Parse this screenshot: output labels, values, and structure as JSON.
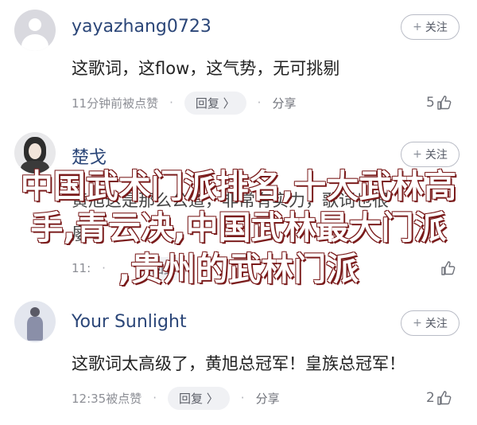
{
  "comments": [
    {
      "username": "yayazhang0723",
      "follow_label": "关注",
      "follow_icon": "+",
      "text": "这歌词，这flow，这气势，无可挑剔",
      "time": "11分钟前被点赞",
      "reply_label": "回复 〉",
      "share_label": "分享",
      "likes": "5",
      "avatar_icon": "default-user-icon"
    },
    {
      "username": "楚戈",
      "follow_label": "关注",
      "follow_icon": "+",
      "text": "黄旭这是那么公道，非常有实力，歌词也很",
      "text2": "屡",
      "time": "11:",
      "reply_label": "回复",
      "share_label": "",
      "likes": "",
      "avatar_icon": "user-photo"
    },
    {
      "username": "Your Sunlight",
      "follow_label": "关注",
      "follow_icon": "+",
      "text": "这歌词太高级了，黄旭总冠军！皇族总冠军！",
      "time": "12:35被点赞",
      "reply_label": "回复 〉",
      "share_label": "分享",
      "likes": "2",
      "avatar_icon": "user-photo"
    }
  ],
  "overlay": {
    "line1": "中国武术门派排名,十大武林高",
    "line2": "手,青云决,中国武林最大门派",
    "line3": ",贵州的武林门派"
  },
  "colors": {
    "username": "#2b4678",
    "overlay_text": "#ffffff",
    "overlay_outline": "#7a1b1b"
  }
}
